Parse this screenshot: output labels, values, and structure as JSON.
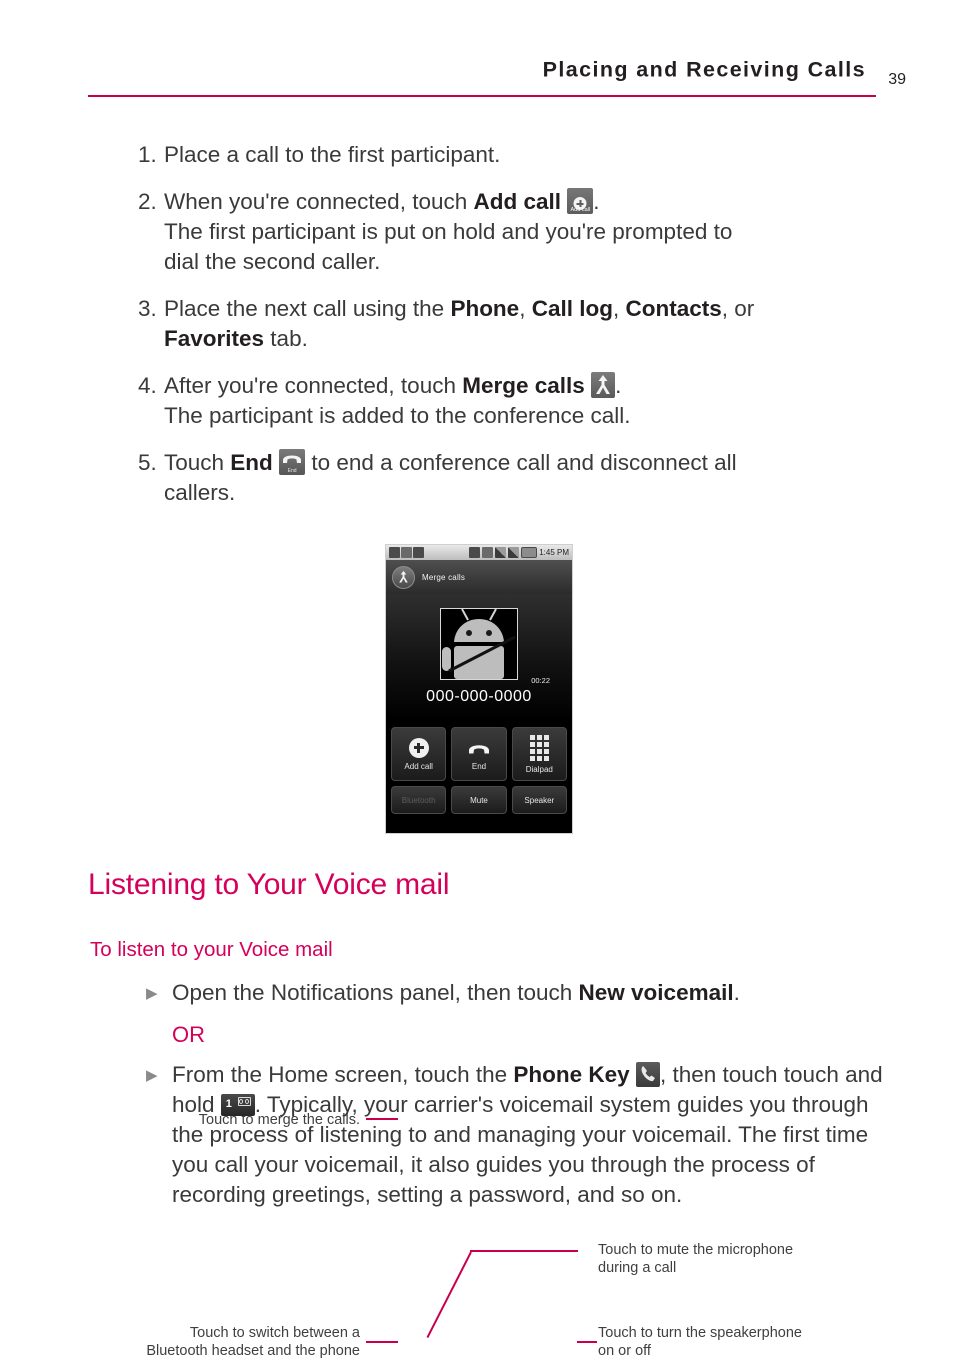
{
  "header": {
    "title": "Placing and Receiving Calls",
    "page_number": "39",
    "rule_color": "#c8004b"
  },
  "steps": [
    {
      "num": "1.",
      "parts": [
        {
          "type": "text",
          "value": "Place a call to the first participant."
        }
      ]
    },
    {
      "num": "2.",
      "parts": [
        {
          "type": "text",
          "value": "When you're connected, touch "
        },
        {
          "type": "bold",
          "value": "Add call"
        },
        {
          "type": "icon",
          "value": "add-call-icon",
          "label": "Add call"
        },
        {
          "type": "text",
          "value": ". The first participant is put on hold and you're prompted to dial the second caller."
        }
      ]
    },
    {
      "num": "3.",
      "parts": [
        {
          "type": "text",
          "value": "Place the next call using the "
        },
        {
          "type": "bold",
          "value": "Phone"
        },
        {
          "type": "text",
          "value": ", "
        },
        {
          "type": "bold",
          "value": "Call log"
        },
        {
          "type": "text",
          "value": ", "
        },
        {
          "type": "bold",
          "value": "Contacts"
        },
        {
          "type": "text",
          "value": ", or "
        },
        {
          "type": "bold",
          "value": "Favorites"
        },
        {
          "type": "text",
          "value": " tab."
        }
      ]
    },
    {
      "num": "4.",
      "parts": [
        {
          "type": "text",
          "value": "After you're connected, touch "
        },
        {
          "type": "bold",
          "value": "Merge calls"
        },
        {
          "type": "icon",
          "value": "merge-calls-icon",
          "label": ""
        },
        {
          "type": "text",
          "value": ". The participant is added to the conference call."
        }
      ]
    },
    {
      "num": "5.",
      "parts": [
        {
          "type": "text",
          "value": "Touch "
        },
        {
          "type": "bold",
          "value": "End"
        },
        {
          "type": "icon",
          "value": "end-call-icon",
          "label": "End"
        },
        {
          "type": "text",
          "value": " to end a conference call and disconnect all callers."
        }
      ]
    }
  ],
  "step_text": {
    "s1": "Place a call to the first participant.",
    "s2_lead": "When you're connected, touch ",
    "s2_bold": "Add call",
    "s2_tail": ".",
    "s2_line2": "The first participant is put on hold and you're prompted to",
    "s2_line3": "dial the second caller.",
    "s3_lead": "Place the next call using the ",
    "s3_b1": "Phone",
    "s3_sep1": ", ",
    "s3_b2": "Call log",
    "s3_sep2": ", ",
    "s3_b3": "Contacts",
    "s3_sep3": ", or",
    "s3_b4": "Favorites",
    "s3_tail": " tab.",
    "s4_lead": "After you're connected, touch ",
    "s4_bold": "Merge calls",
    "s4_tail": ".",
    "s4_line2": "The participant is added to the conference call.",
    "s5_lead": "Touch ",
    "s5_bold": "End",
    "s5_tail": " to end a conference call and disconnect all",
    "s5_line2": "callers."
  },
  "figure": {
    "callouts": {
      "merge": "Touch to merge the calls.",
      "bluetooth_line1": "Touch to switch between a",
      "bluetooth_line2": "Bluetooth headset and the phone",
      "mute_line1": "Touch to mute the microphone",
      "mute_line2": "during a call",
      "speaker_line1": "Touch to turn the speakerphone",
      "speaker_line2": "on or off"
    },
    "phone": {
      "status_time": "1:45 PM",
      "merge_bar_label": "Merge calls",
      "call_timer": "00:22",
      "call_number": "000-000-0000",
      "buttons": [
        {
          "label": "Add call",
          "icon": "add-call-icon",
          "disabled": false
        },
        {
          "label": "End",
          "icon": "end-call-icon",
          "disabled": false
        },
        {
          "label": "Dialpad",
          "icon": "dialpad-icon",
          "disabled": false
        },
        {
          "label": "Bluetooth",
          "icon": "bluetooth-toggle",
          "disabled": true
        },
        {
          "label": "Mute",
          "icon": "mute-toggle",
          "disabled": false
        },
        {
          "label": "Speaker",
          "icon": "speaker-toggle",
          "disabled": false
        }
      ],
      "status_icons_left": [
        "usb-icon",
        "sync-icon",
        "phone-icon"
      ],
      "status_icons_right": [
        "gps-icon",
        "vibrate-icon",
        "network-icon",
        "signal-icon",
        "battery-icon"
      ]
    }
  },
  "section": {
    "title": "Listening to Your Voice mail",
    "subtitle": "To listen to your Voice mail",
    "accent_color": "#d5005a"
  },
  "bullets": {
    "mark": "▶",
    "b1_lead": "Open the Notifications panel, then touch ",
    "b1_bold": "New voicemail",
    "b1_tail": ".",
    "or": "OR",
    "b2_lead": "From the Home screen, touch the ",
    "b2_bold": "Phone Key",
    "b2_mid": ", then touch touch and hold ",
    "b2_tail": ". Typically, your carrier's voicemail system guides you through the process of listening to and managing your voicemail. The first time you call your voicemail, it also guides you through the process of recording greetings, setting a password, and so on."
  }
}
